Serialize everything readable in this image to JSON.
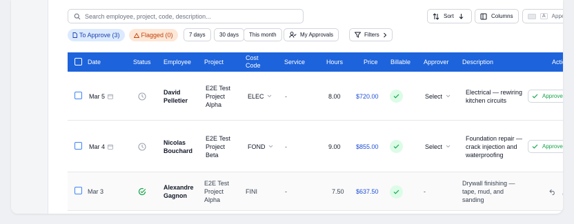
{
  "toolbar": {
    "search_placeholder": "Search employee, project, code, description...",
    "sort_label": "Sort",
    "columns_label": "Columns",
    "appearance_key": "A",
    "appearance_label": "Appe"
  },
  "filters": {
    "to_approve": "To Approve (3)",
    "flagged": "Flagged (0)",
    "days7": "7 days",
    "days30": "30 days",
    "this_month": "This month",
    "my_approvals": "My Approvals",
    "filters": "Filters"
  },
  "table": {
    "headers": {
      "date": "Date",
      "status": "Status",
      "employee": "Employee",
      "project": "Project",
      "cost_code": "Cost Code",
      "service": "Service",
      "hours": "Hours",
      "price": "Price",
      "billable": "Billable",
      "approver": "Approver",
      "description": "Description",
      "actions": "Actio"
    },
    "rows": [
      {
        "date": "Mar 5",
        "employee": "David Pelletier",
        "project": "E2E Test Project Alpha",
        "cost_code": "ELEC",
        "service": "-",
        "hours": "8.00",
        "price": "$720.00",
        "approver": "Select",
        "description": "Electrical — rewiring kitchen circuits",
        "action": "Approve"
      },
      {
        "date": "Mar 4",
        "employee": "Nicolas Bouchard",
        "project": "E2E Test Project Beta",
        "cost_code": "FOND",
        "service": "-",
        "hours": "9.00",
        "price": "$855.00",
        "approver": "Select",
        "description": "Foundation repair — crack injection and waterproofing",
        "action": "Approve"
      },
      {
        "date": "Mar 3",
        "employee": "Alexandre Gagnon",
        "project": "E2E Test Project Alpha",
        "cost_code": "FINI",
        "service": "-",
        "hours": "7.50",
        "price": "$637.50",
        "approver": "-",
        "description": "Drywall finishing — tape, mud, and sanding"
      }
    ]
  }
}
